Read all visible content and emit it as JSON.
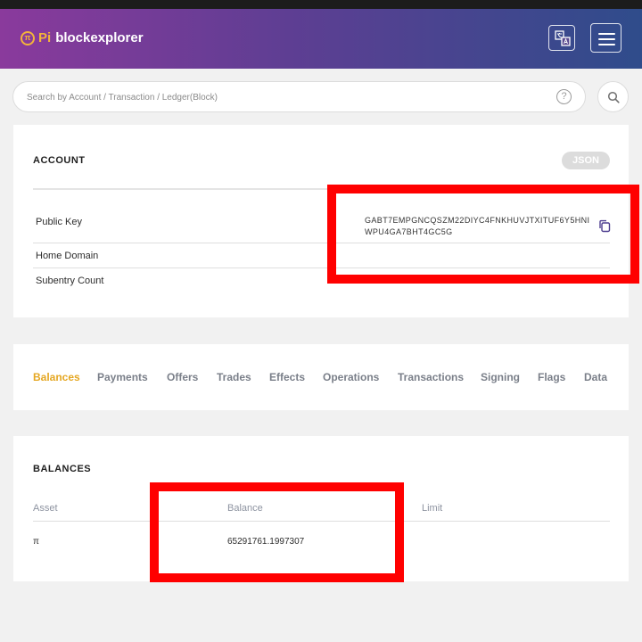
{
  "header": {
    "logo_symbol": "π",
    "logo_pi": "Pi",
    "logo_name": "blockexplorer",
    "translate_icon": "translate-icon",
    "menu_icon": "hamburger-menu-icon"
  },
  "search": {
    "placeholder": "Search by Account / Transaction / Ledger(Block)",
    "help": "?"
  },
  "account": {
    "title": "ACCOUNT",
    "json_label": "JSON",
    "rows": [
      {
        "label": "Public Key",
        "value": "GABT7EMPGNCQSZM22DIYC4FNKHUVJTXITUF6Y5HNIWPU4GA7BHT4GC5G"
      },
      {
        "label": "Home Domain"
      },
      {
        "label": "Subentry Count"
      }
    ]
  },
  "tabs": [
    "Balances",
    "Payments",
    "Offers",
    "Trades",
    "Effects",
    "Operations",
    "Transactions",
    "Signing",
    "Flags",
    "Data"
  ],
  "active_tab": "Balances",
  "balances": {
    "title": "BALANCES",
    "columns": [
      "Asset",
      "Balance",
      "Limit"
    ],
    "rows": [
      {
        "asset": "π",
        "balance": "65291761.1997307",
        "limit": ""
      }
    ]
  },
  "colors": {
    "accent": "#e5a722",
    "highlight": "#ff0000",
    "header_start": "#8a3a9c",
    "header_end": "#2f4c8b"
  }
}
